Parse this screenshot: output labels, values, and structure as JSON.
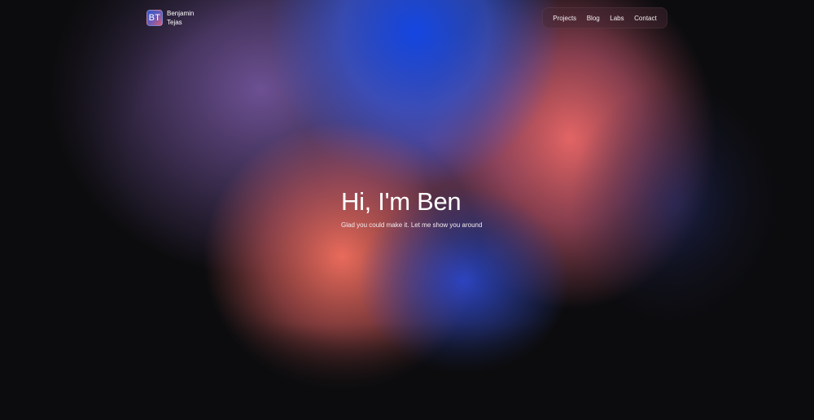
{
  "brand": {
    "initials": "BT",
    "first_name": "Benjamin",
    "last_name": "Tejas"
  },
  "nav": {
    "items": [
      {
        "label": "Projects"
      },
      {
        "label": "Blog"
      },
      {
        "label": "Labs"
      },
      {
        "label": "Contact"
      }
    ]
  },
  "hero": {
    "title": "Hi, I'm Ben",
    "subtitle": "Glad you could make it. Let me show you around"
  },
  "colors": {
    "background": "#0c0c0e",
    "blue": "#1446e1",
    "coral": "#f5705f",
    "purple": "#7d5caa"
  }
}
